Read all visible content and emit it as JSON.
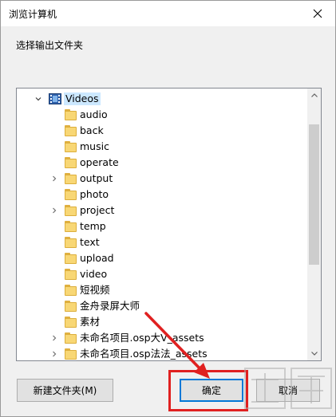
{
  "window": {
    "title": "浏览计算机",
    "close_label": "×"
  },
  "prompt": "选择输出文件夹",
  "tree": {
    "root": "Videos",
    "items": [
      {
        "label": "audio",
        "expandable": false
      },
      {
        "label": "back",
        "expandable": false
      },
      {
        "label": "music",
        "expandable": false
      },
      {
        "label": "operate",
        "expandable": false
      },
      {
        "label": "output",
        "expandable": true
      },
      {
        "label": "photo",
        "expandable": false
      },
      {
        "label": "project",
        "expandable": true
      },
      {
        "label": "temp",
        "expandable": false
      },
      {
        "label": "text",
        "expandable": false
      },
      {
        "label": "upload",
        "expandable": false
      },
      {
        "label": "video",
        "expandable": false
      },
      {
        "label": "短视频",
        "expandable": false
      },
      {
        "label": "金舟录屏大师",
        "expandable": false
      },
      {
        "label": "素材",
        "expandable": false
      },
      {
        "label": "未命名项目.osp大V_assets",
        "expandable": true
      },
      {
        "label": "未命名项目.osp法法_assets",
        "expandable": true
      }
    ]
  },
  "buttons": {
    "new_folder": "新建文件夹(M)",
    "ok": "确定",
    "cancel": "取消"
  },
  "colors": {
    "selection": "#cce8ff",
    "annotation": "#e02020",
    "accent": "#0078d7"
  }
}
